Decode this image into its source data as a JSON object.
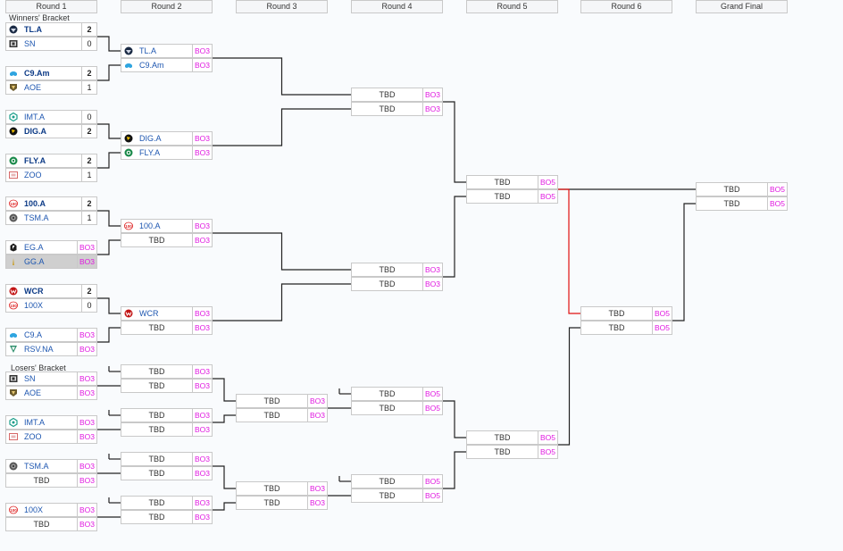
{
  "headers": [
    "Round 1",
    "Round 2",
    "Round 3",
    "Round 4",
    "Round 5",
    "Round 6",
    "Grand Final"
  ],
  "winners_label": "Winners' Bracket",
  "losers_label": "Losers' Bracket",
  "colors": {
    "bestof": "#e019e0",
    "line": "#222222",
    "highlight": "#e01010",
    "border": "#c9c9c9"
  },
  "rounds": {
    "r1_winners": [
      [
        {
          "team": "TL.A",
          "score": "2",
          "win": true,
          "logo": "tl-logo-icon"
        },
        {
          "team": "SN",
          "score": "0",
          "logo": "sn-logo-icon"
        }
      ],
      [
        {
          "team": "C9.Am",
          "score": "2",
          "win": true,
          "logo": "c9-logo-icon"
        },
        {
          "team": "AOE",
          "score": "1",
          "logo": "aoe-logo-icon"
        }
      ],
      [
        {
          "team": "IMT.A",
          "score": "0",
          "logo": "imt-logo-icon"
        },
        {
          "team": "DIG.A",
          "score": "2",
          "win": true,
          "logo": "dig-logo-icon"
        }
      ],
      [
        {
          "team": "FLY.A",
          "score": "2",
          "win": true,
          "logo": "fly-logo-icon"
        },
        {
          "team": "ZOO",
          "score": "1",
          "logo": "zoo-logo-icon"
        }
      ],
      [
        {
          "team": "100.A",
          "score": "2",
          "win": true,
          "logo": "100-logo-icon"
        },
        {
          "team": "TSM.A",
          "score": "1",
          "logo": "tsm-logo-icon"
        }
      ],
      [
        {
          "team": "EG.A",
          "score": "BO3",
          "logo": "eg-logo-icon"
        },
        {
          "team": "GG.A",
          "score": "BO3",
          "logo": "gg-logo-icon",
          "grey": true
        }
      ],
      [
        {
          "team": "WCR",
          "score": "2",
          "win": true,
          "logo": "wcr-logo-icon"
        },
        {
          "team": "100X",
          "score": "0",
          "logo": "100-logo-icon"
        }
      ],
      [
        {
          "team": "C9.A",
          "score": "BO3",
          "logo": "c9-logo-icon"
        },
        {
          "team": "RSV.NA",
          "score": "BO3",
          "logo": "rsv-logo-icon"
        }
      ]
    ],
    "r1_losers": [
      [
        {
          "team": "SN",
          "score": "BO3",
          "logo": "sn-logo-icon"
        },
        {
          "team": "AOE",
          "score": "BO3",
          "logo": "aoe-logo-icon"
        }
      ],
      [
        {
          "team": "IMT.A",
          "score": "BO3",
          "logo": "imt-logo-icon"
        },
        {
          "team": "ZOO",
          "score": "BO3",
          "logo": "zoo-logo-icon"
        }
      ],
      [
        {
          "team": "TSM.A",
          "score": "BO3",
          "logo": "tsm-logo-icon"
        },
        {
          "team": "TBD",
          "score": "BO3"
        }
      ],
      [
        {
          "team": "100X",
          "score": "BO3",
          "logo": "100-logo-icon"
        },
        {
          "team": "TBD",
          "score": "BO3"
        }
      ]
    ],
    "r2_winners": [
      [
        {
          "team": "TL.A",
          "score": "BO3",
          "logo": "tl-logo-icon"
        },
        {
          "team": "C9.Am",
          "score": "BO3",
          "logo": "c9-logo-icon"
        }
      ],
      [
        {
          "team": "DIG.A",
          "score": "BO3",
          "logo": "dig-logo-icon"
        },
        {
          "team": "FLY.A",
          "score": "BO3",
          "logo": "fly-logo-icon"
        }
      ],
      [
        {
          "team": "100.A",
          "score": "BO3",
          "logo": "100-logo-icon"
        },
        {
          "team": "TBD",
          "score": "BO3"
        }
      ],
      [
        {
          "team": "WCR",
          "score": "BO3",
          "logo": "wcr-logo-icon"
        },
        {
          "team": "TBD",
          "score": "BO3"
        }
      ]
    ],
    "r2_losers": [
      [
        {
          "team": "TBD",
          "score": "BO3"
        },
        {
          "team": "TBD",
          "score": "BO3"
        }
      ],
      [
        {
          "team": "TBD",
          "score": "BO3"
        },
        {
          "team": "TBD",
          "score": "BO3"
        }
      ],
      [
        {
          "team": "TBD",
          "score": "BO3"
        },
        {
          "team": "TBD",
          "score": "BO3"
        }
      ],
      [
        {
          "team": "TBD",
          "score": "BO3"
        },
        {
          "team": "TBD",
          "score": "BO3"
        }
      ]
    ],
    "r3_losers": [
      [
        {
          "team": "TBD",
          "score": "BO3"
        },
        {
          "team": "TBD",
          "score": "BO3"
        }
      ],
      [
        {
          "team": "TBD",
          "score": "BO3"
        },
        {
          "team": "TBD",
          "score": "BO3"
        }
      ]
    ],
    "r4_winners": [
      [
        {
          "team": "TBD",
          "score": "BO3"
        },
        {
          "team": "TBD",
          "score": "BO3"
        }
      ],
      [
        {
          "team": "TBD",
          "score": "BO3"
        },
        {
          "team": "TBD",
          "score": "BO3"
        }
      ]
    ],
    "r4_losers": [
      [
        {
          "team": "TBD",
          "score": "BO5"
        },
        {
          "team": "TBD",
          "score": "BO5"
        }
      ],
      [
        {
          "team": "TBD",
          "score": "BO5"
        },
        {
          "team": "TBD",
          "score": "BO5"
        }
      ]
    ],
    "r5_winners": [
      [
        {
          "team": "TBD",
          "score": "BO5"
        },
        {
          "team": "TBD",
          "score": "BO5"
        }
      ]
    ],
    "r5_losers": [
      [
        {
          "team": "TBD",
          "score": "BO5"
        },
        {
          "team": "TBD",
          "score": "BO5"
        }
      ]
    ],
    "r6": [
      [
        {
          "team": "TBD",
          "score": "BO5"
        },
        {
          "team": "TBD",
          "score": "BO5"
        }
      ]
    ],
    "grand_final": [
      [
        {
          "team": "TBD",
          "score": "BO5"
        },
        {
          "team": "TBD",
          "score": "BO5"
        }
      ]
    ]
  }
}
